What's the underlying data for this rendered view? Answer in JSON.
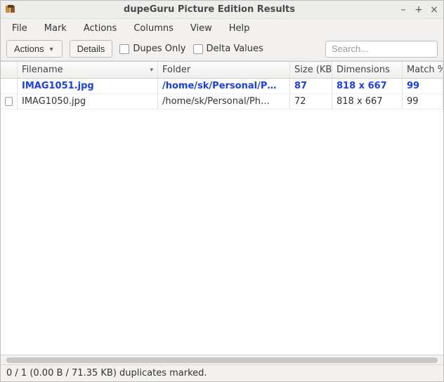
{
  "window": {
    "title": "dupeGuru Picture Edition Results"
  },
  "menubar": {
    "items": [
      "File",
      "Mark",
      "Actions",
      "Columns",
      "View",
      "Help"
    ]
  },
  "toolbar": {
    "actions_label": "Actions",
    "details_label": "Details",
    "dupes_only_label": "Dupes Only",
    "delta_values_label": "Delta Values",
    "search_placeholder": "Search..."
  },
  "columns": {
    "filename": "Filename",
    "folder": "Folder",
    "size": "Size (KB)",
    "dimensions": "Dimensions",
    "match": "Match %"
  },
  "rows": [
    {
      "filename": "IMAG1051.jpg",
      "folder": "/home/sk/Personal/P…",
      "size": "87",
      "dimensions": "818 x 667",
      "match": "99",
      "primary": true,
      "checkable": false
    },
    {
      "filename": "IMAG1050.jpg",
      "folder": "/home/sk/Personal/Ph…",
      "size": "72",
      "dimensions": "818 x 667",
      "match": "99",
      "primary": false,
      "checkable": true
    }
  ],
  "statusbar": {
    "text": "0 / 1 (0.00 B / 71.35 KB) duplicates marked."
  }
}
